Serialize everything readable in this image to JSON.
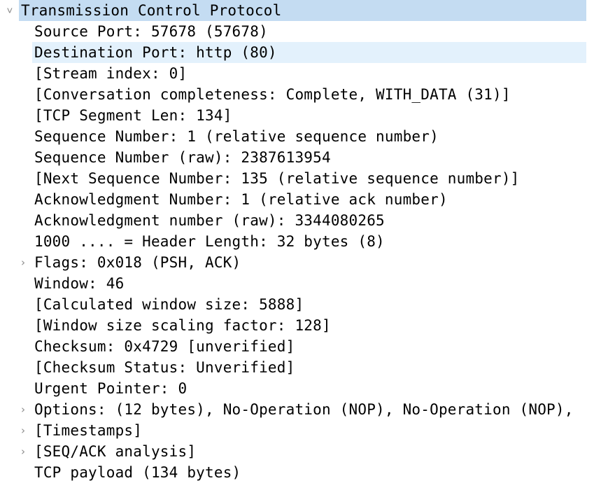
{
  "tree": {
    "root": {
      "label": "Transmission Control Protocol",
      "expanded": true,
      "selected": true
    },
    "children": [
      {
        "label": "Source Port: 57678 (57678)",
        "expandable": false
      },
      {
        "label": "Destination Port: http (80)",
        "expandable": false,
        "hover": true
      },
      {
        "label": "[Stream index: 0]",
        "expandable": false
      },
      {
        "label": "[Conversation completeness: Complete, WITH_DATA (31)]",
        "expandable": false
      },
      {
        "label": "[TCP Segment Len: 134]",
        "expandable": false
      },
      {
        "label": "Sequence Number: 1    (relative sequence number)",
        "expandable": false
      },
      {
        "label": "Sequence Number (raw): 2387613954",
        "expandable": false
      },
      {
        "label": "[Next Sequence Number: 135    (relative sequence number)]",
        "expandable": false
      },
      {
        "label": "Acknowledgment Number: 1    (relative ack number)",
        "expandable": false
      },
      {
        "label": "Acknowledgment number (raw): 3344080265",
        "expandable": false
      },
      {
        "label": "1000 .... = Header Length: 32 bytes (8)",
        "expandable": false
      },
      {
        "label": "Flags: 0x018 (PSH, ACK)",
        "expandable": true
      },
      {
        "label": "Window: 46",
        "expandable": false
      },
      {
        "label": "[Calculated window size: 5888]",
        "expandable": false
      },
      {
        "label": "[Window size scaling factor: 128]",
        "expandable": false
      },
      {
        "label": "Checksum: 0x4729 [unverified]",
        "expandable": false
      },
      {
        "label": "[Checksum Status: Unverified]",
        "expandable": false
      },
      {
        "label": "Urgent Pointer: 0",
        "expandable": false
      },
      {
        "label": "Options: (12 bytes), No-Operation (NOP), No-Operation (NOP),",
        "expandable": true
      },
      {
        "label": "[Timestamps]",
        "expandable": true
      },
      {
        "label": "[SEQ/ACK analysis]",
        "expandable": true
      },
      {
        "label": "TCP payload (134 bytes)",
        "expandable": false
      }
    ],
    "icons": {
      "expanded": "chevron-down-icon",
      "collapsed": "chevron-right-icon"
    },
    "colors": {
      "selected_bg": "#c4dcf2",
      "hover_bg": "#e3f1fc",
      "arrow": "#8a8a8a"
    }
  }
}
